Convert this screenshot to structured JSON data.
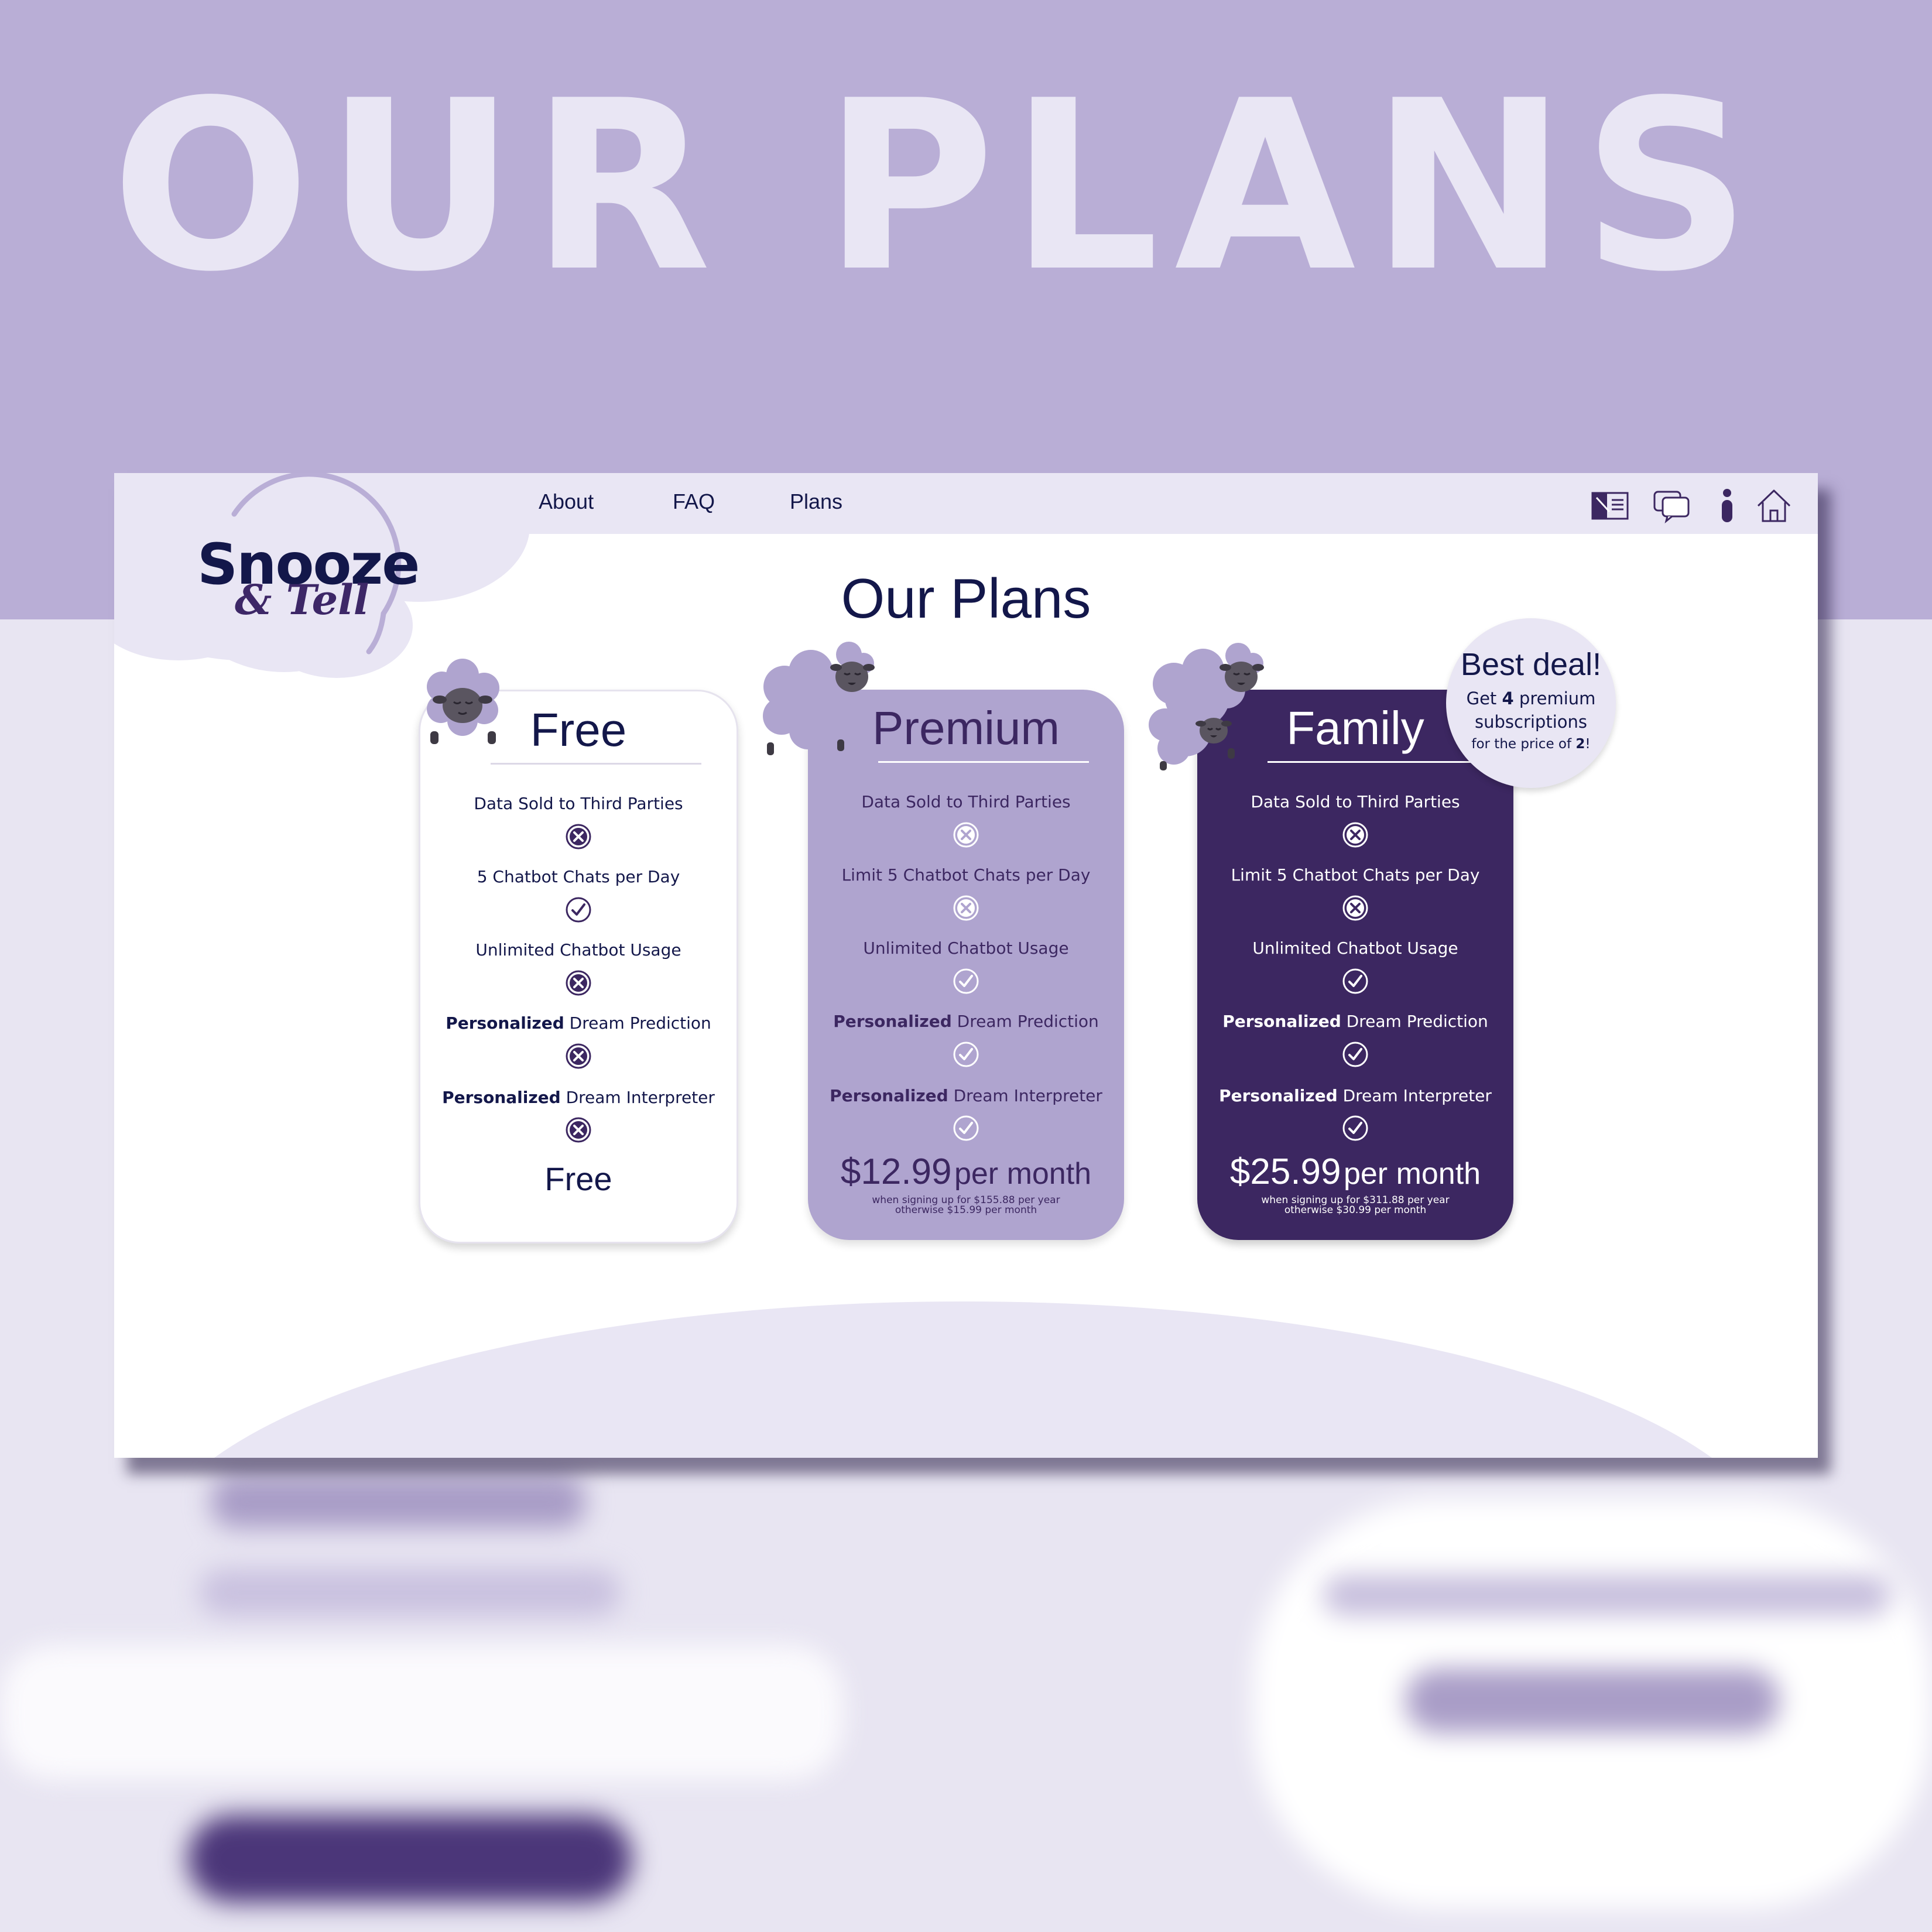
{
  "hero": {
    "title": "OUR PLANS"
  },
  "logo": {
    "line1": "Snooze",
    "line2": "& Tell"
  },
  "nav": {
    "about": "About",
    "faq": "FAQ",
    "plans": "Plans"
  },
  "icons": {
    "journal": "journal-icon",
    "chat": "chat-bubbles-icon",
    "info": "info-person-icon",
    "home": "home-icon"
  },
  "page_title": "Our Plans",
  "plans": [
    {
      "name": "Free",
      "features": [
        {
          "bold": "",
          "text": "Data Sold to Third Parties",
          "included": false
        },
        {
          "bold": "",
          "text": "5 Chatbot Chats per Day",
          "included": true
        },
        {
          "bold": "",
          "text": "Unlimited Chatbot Usage",
          "included": false
        },
        {
          "bold": "Personalized",
          "text": "Dream Prediction",
          "included": false
        },
        {
          "bold": "Personalized",
          "text": "Dream Interpreter",
          "included": false
        }
      ],
      "price": "Free",
      "note1": "",
      "note2": ""
    },
    {
      "name": "Premium",
      "features": [
        {
          "bold": "",
          "text": "Data Sold to Third Parties",
          "included": false
        },
        {
          "bold": "",
          "text": "Limit 5 Chatbot Chats per Day",
          "included": false
        },
        {
          "bold": "",
          "text": "Unlimited Chatbot Usage",
          "included": true
        },
        {
          "bold": "Personalized",
          "text": "Dream Prediction",
          "included": true
        },
        {
          "bold": "Personalized",
          "text": "Dream Interpreter",
          "included": true
        }
      ],
      "price_amount": "$12.99",
      "price_suffix": "per month",
      "note1": "when signing up for $155.88 per year",
      "note2": "otherwise $15.99 per month"
    },
    {
      "name": "Family",
      "features": [
        {
          "bold": "",
          "text": "Data Sold to Third Parties",
          "included": false
        },
        {
          "bold": "",
          "text": "Limit 5 Chatbot Chats per Day",
          "included": false
        },
        {
          "bold": "",
          "text": "Unlimited Chatbot Usage",
          "included": true
        },
        {
          "bold": "Personalized",
          "text": "Dream Prediction",
          "included": true
        },
        {
          "bold": "Personalized",
          "text": "Dream Interpreter",
          "included": true
        }
      ],
      "price_amount": "$25.99",
      "price_suffix": "per month",
      "note1": "when signing up for $311.88 per year",
      "note2": "otherwise $30.99 per month"
    }
  ],
  "badge": {
    "title": "Best deal!",
    "line1_pre": "Get ",
    "line1_bold": "4",
    "line1_post": " premium",
    "line2": "subscriptions",
    "line3_pre": "for the price of ",
    "line3_bold": "2",
    "line3_post": "!"
  },
  "colors": {
    "brand_dark": "#13174A",
    "brand_purple": "#3C2761",
    "lavender": "#AFA4CF",
    "pale": "#E9E6F4",
    "top_band": "#B9AED6"
  }
}
